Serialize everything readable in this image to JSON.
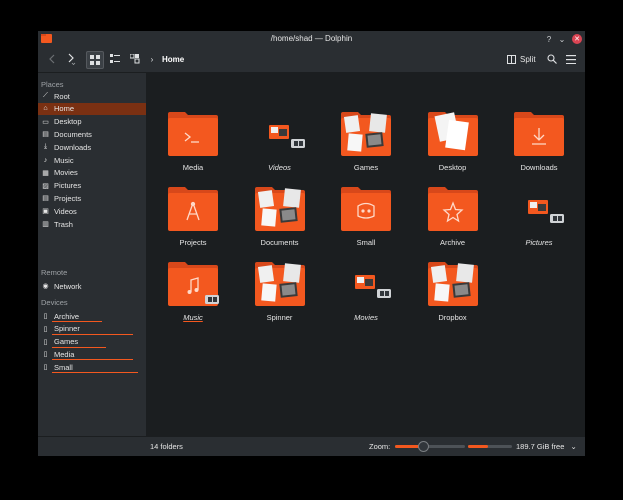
{
  "window": {
    "title": "/home/shad — Dolphin"
  },
  "toolbar": {
    "breadcrumb": "Home",
    "split_label": "Split"
  },
  "sidebar": {
    "places_header": "Places",
    "places": [
      {
        "label": "Root",
        "icon": "root-icon"
      },
      {
        "label": "Home",
        "icon": "home-icon",
        "active": true
      },
      {
        "label": "Desktop",
        "icon": "desktop-icon"
      },
      {
        "label": "Documents",
        "icon": "documents-icon"
      },
      {
        "label": "Downloads",
        "icon": "downloads-icon"
      },
      {
        "label": "Music",
        "icon": "music-icon"
      },
      {
        "label": "Movies",
        "icon": "movies-icon"
      },
      {
        "label": "Pictures",
        "icon": "pictures-icon"
      },
      {
        "label": "Projects",
        "icon": "projects-icon"
      },
      {
        "label": "Videos",
        "icon": "videos-icon"
      },
      {
        "label": "Trash",
        "icon": "trash-icon"
      }
    ],
    "remote_header": "Remote",
    "remote": [
      {
        "label": "Network",
        "icon": "network-icon"
      }
    ],
    "devices_header": "Devices",
    "devices": [
      {
        "label": "Archive",
        "icon": "drive-icon",
        "usage": 0.55
      },
      {
        "label": "Spinner",
        "icon": "drive-icon",
        "usage": 0.9
      },
      {
        "label": "Games",
        "icon": "drive-icon",
        "usage": 0.6
      },
      {
        "label": "Media",
        "icon": "drive-icon",
        "usage": 0.9
      },
      {
        "label": "Small",
        "icon": "drive-icon",
        "usage": 0.95
      }
    ]
  },
  "folders": [
    {
      "label": "Media",
      "kind": "folder",
      "emblem": "terminal-icon"
    },
    {
      "label": "Videos",
      "kind": "mount",
      "italic": true
    },
    {
      "label": "Games",
      "kind": "preview"
    },
    {
      "label": "Desktop",
      "kind": "preview-doc"
    },
    {
      "label": "Downloads",
      "kind": "folder",
      "emblem": "download-icon"
    },
    {
      "label": "Projects",
      "kind": "folder",
      "emblem": "compass-icon"
    },
    {
      "label": "Documents",
      "kind": "preview"
    },
    {
      "label": "Small",
      "kind": "folder",
      "emblem": "godot-icon"
    },
    {
      "label": "Archive",
      "kind": "folder",
      "emblem": "star-icon"
    },
    {
      "label": "Pictures",
      "kind": "mount",
      "italic": true
    },
    {
      "label": "Music",
      "kind": "folder",
      "emblem": "music-icon",
      "italic": true,
      "underline": true,
      "mounted": true
    },
    {
      "label": "Spinner",
      "kind": "preview"
    },
    {
      "label": "Movies",
      "kind": "mount",
      "italic": true
    },
    {
      "label": "Dropbox",
      "kind": "preview"
    }
  ],
  "status": {
    "count": "14 folders",
    "zoom_label": "Zoom:",
    "zoom_level": 0.4,
    "free_label": "189.7 GiB free",
    "used_fraction": 0.45
  },
  "colors": {
    "accent": "#f3581f",
    "folder": "#f3581f",
    "folder_dark": "#d8481a"
  }
}
